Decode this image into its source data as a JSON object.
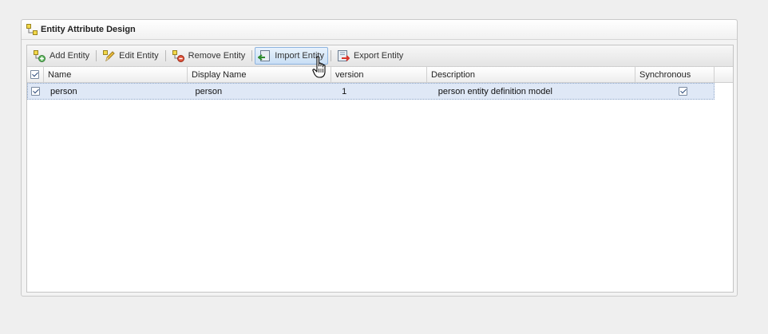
{
  "panel": {
    "title": "Entity Attribute Design",
    "title_icon": "entity-nodes-icon"
  },
  "toolbar": {
    "buttons": [
      {
        "label": "Add Entity",
        "icon": "add-entity-icon"
      },
      {
        "label": "Edit Entity",
        "icon": "edit-pencil-icon"
      },
      {
        "label": "Remove Entity",
        "icon": "remove-entity-icon"
      },
      {
        "label": "Import Entity",
        "icon": "import-icon",
        "hovered": true
      },
      {
        "label": "Export Entity",
        "icon": "export-icon"
      }
    ]
  },
  "grid": {
    "columns": [
      "Name",
      "Display Name",
      "version",
      "Description",
      "Synchronous"
    ],
    "rows": [
      {
        "checked": true,
        "name": "person",
        "display_name": "person",
        "version": "1",
        "description": "person entity definition model",
        "synchronous": true
      }
    ]
  },
  "colors": {
    "selected_row": "#dfe8f6",
    "hover_border": "#8eb4df"
  }
}
